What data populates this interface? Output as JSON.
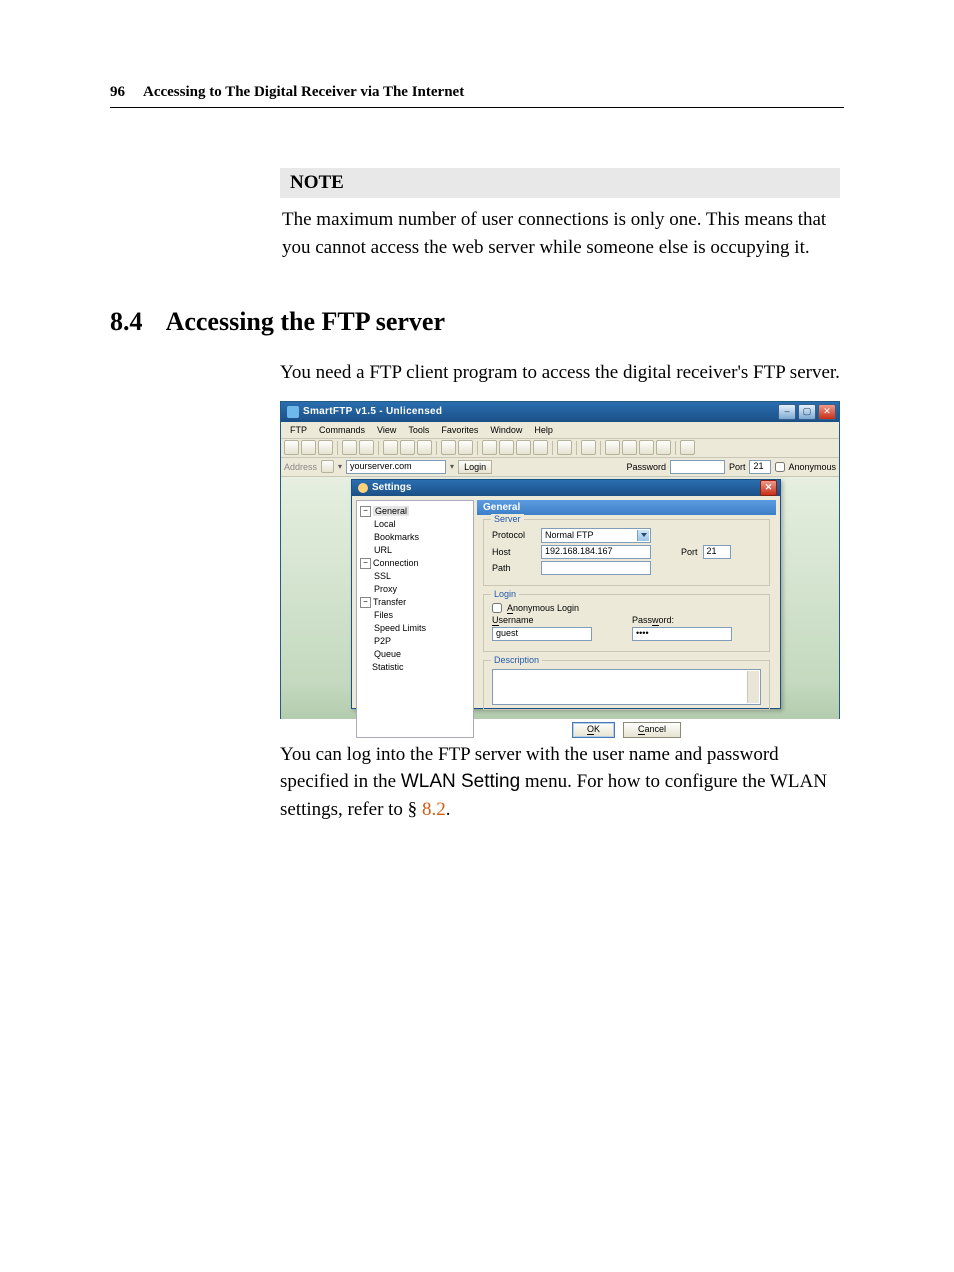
{
  "head": {
    "page": "96",
    "title": "Accessing to The Digital Receiver via The Internet"
  },
  "note": {
    "label": "NOTE",
    "text": "The maximum number of user connections is only one. This means that you cannot access the web server while someone else is occupying it."
  },
  "sect": {
    "number": "8.4",
    "title": "Accessing the FTP server"
  },
  "p1": "You need a FTP client program to access the digital receiver's FTP server.",
  "p2a": "You can log into the FTP server with the user name and pass­word specified in the ",
  "p2menu": "WLAN Setting",
  "p2b": " menu. For how to config­ure the WLAN settings, refer to § ",
  "p2ref": "8.2",
  "p2c": ".",
  "app": {
    "title": "SmartFTP v1.5 - Unlicensed",
    "menu": [
      "FTP",
      "Commands",
      "View",
      "Tools",
      "Favorites",
      "Window",
      "Help"
    ],
    "addr": {
      "label": "Address",
      "value": "yourserver.com",
      "login": "Login",
      "pwlabel": "Password",
      "pw": "",
      "portlabel": "Port",
      "port": "21",
      "anon": "Anonymous"
    },
    "settings": {
      "title": "Settings",
      "tree": [
        {
          "label": "General",
          "level": 0,
          "exp": "−",
          "sel": true
        },
        {
          "label": "Local",
          "level": 1
        },
        {
          "label": "Bookmarks",
          "level": 1
        },
        {
          "label": "URL",
          "level": 1
        },
        {
          "label": "Connection",
          "level": 0,
          "exp": "−"
        },
        {
          "label": "SSL",
          "level": 1
        },
        {
          "label": "Proxy",
          "level": 1
        },
        {
          "label": "Transfer",
          "level": 0,
          "exp": "−"
        },
        {
          "label": "Files",
          "level": 1
        },
        {
          "label": "Speed Limits",
          "level": 1
        },
        {
          "label": "P2P",
          "level": 1
        },
        {
          "label": "Queue",
          "level": 1
        },
        {
          "label": "Statistic",
          "level": 0
        }
      ],
      "panel": "General",
      "server": {
        "legend": "Server",
        "protocol_l": "Protocol",
        "protocol": "Normal FTP",
        "host_l": "Host",
        "host": "192.168.184.167",
        "port_l": "Port",
        "port": "21",
        "path_l": "Path",
        "path": ""
      },
      "login": {
        "legend": "Login",
        "anon_l": "Anonymous Login",
        "user_l": "Username",
        "user": "guest",
        "pass_l": "Password:",
        "pass": "••••"
      },
      "desc": {
        "legend": "Description"
      },
      "ok": "OK",
      "cancel": "Cancel"
    }
  },
  "chart_data": {
    "type": "table",
    "title": "FTP Client Settings — General",
    "fields": [
      {
        "name": "Protocol",
        "value": "Normal FTP"
      },
      {
        "name": "Host",
        "value": "192.168.184.167"
      },
      {
        "name": "Port",
        "value": 21
      },
      {
        "name": "Path",
        "value": ""
      },
      {
        "name": "Anonymous Login",
        "value": false
      },
      {
        "name": "Username",
        "value": "guest"
      },
      {
        "name": "Password",
        "value": "****"
      }
    ]
  }
}
